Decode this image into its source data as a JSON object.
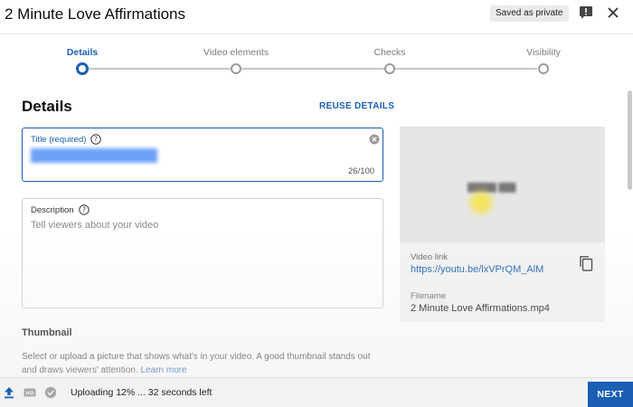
{
  "header": {
    "title": "2 Minute Love Affirmations",
    "saved_badge": "Saved as private",
    "feedback_icon": "feedback-icon",
    "close_icon": "close-icon"
  },
  "stepper": {
    "steps": [
      {
        "label": "Details",
        "active": true
      },
      {
        "label": "Video elements",
        "active": false
      },
      {
        "label": "Checks",
        "active": false
      },
      {
        "label": "Visibility",
        "active": false
      }
    ]
  },
  "details": {
    "heading": "Details",
    "reuse_label": "REUSE DETAILS",
    "title_field": {
      "label": "Title (required)",
      "value": "",
      "char_count": "26/100"
    },
    "description_field": {
      "label": "Description",
      "placeholder": "Tell viewers about your video"
    },
    "thumbnail": {
      "heading": "Thumbnail",
      "text": "Select or upload a picture that shows what's in your video. A good thumbnail stands out and draws viewers' attention.",
      "learn_more": "Learn more"
    }
  },
  "video_panel": {
    "video_link_label": "Video link",
    "video_link": "https://youtu.be/lxVPrQM_AlM",
    "filename_label": "Filename",
    "filename": "2 Minute Love Affirmations.mp4"
  },
  "footer": {
    "status": "Uploading 12% ... 32 seconds left",
    "next_label": "NEXT"
  },
  "colors": {
    "accent": "#1a5fb4",
    "footer_bg": "#f2f2f2",
    "panel_bg": "#f2f2f2"
  }
}
